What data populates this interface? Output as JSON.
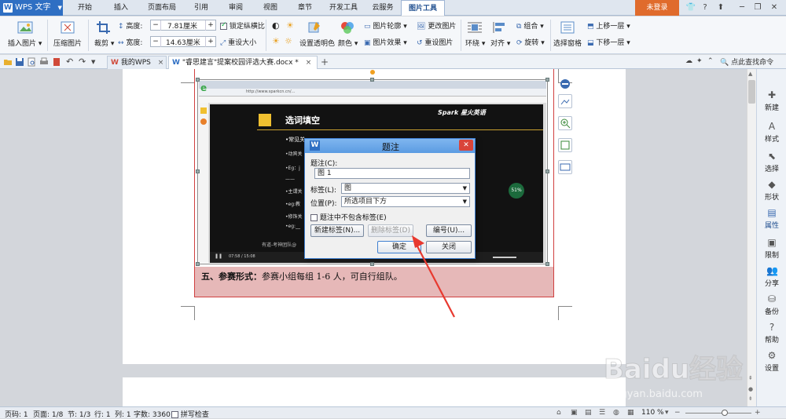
{
  "app": {
    "name": "WPS 文字"
  },
  "menu_tabs": [
    "开始",
    "插入",
    "页面布局",
    "引用",
    "审阅",
    "视图",
    "章节",
    "开发工具",
    "云服务",
    "图片工具"
  ],
  "active_tab": "图片工具",
  "login": "未登录",
  "ribbon": {
    "insert_picture": "插入图片",
    "compress_picture": "压缩图片",
    "crop": "裁剪",
    "height_label": "高度:",
    "height_value": "7.81厘米",
    "width_label": "宽度:",
    "width_value": "14.63厘米",
    "lock_ratio": "锁定纵横比",
    "reset_size": "重设大小",
    "set_transparent": "设置透明色",
    "color": "颜色",
    "outline": "图片轮廓",
    "effect": "图片效果",
    "change_picture": "更改图片",
    "reset_picture": "重设图片",
    "wrap": "环绕",
    "align": "对齐",
    "group": "组合",
    "rotate": "旋转",
    "selection_pane": "选择窗格",
    "bring_forward": "上移一层",
    "send_backward": "下移一层"
  },
  "doc_tabs": {
    "my_wps": "我的WPS",
    "doc_name": "\"睿思建言\"提案校园评选大赛.docx *",
    "search_cmd": "点此查找命令"
  },
  "document": {
    "heading": "五、参赛形式：",
    "body": "参赛小组每组 1-6 人，可自行组队。"
  },
  "embedded_screenshot": {
    "url": "http://www.sparkcn.cn/...",
    "slide_title": "选词填空",
    "brand": "Spark 星火英语",
    "bullets": [
      "•常见关",
      "•动宾关",
      "•Eg：j",
      "——",
      "•主谓关",
      "•eg:教",
      "•修饰关",
      "•eg:__"
    ],
    "footer_text": "有道-考神团队@",
    "time": "07:58 / 15:08",
    "percent": "51%"
  },
  "dialog": {
    "title": "题注",
    "caption_label": "题注(C):",
    "caption_value": "图 1",
    "label_label": "标签(L):",
    "label_value": "图",
    "position_label": "位置(P):",
    "position_value": "所选项目下方",
    "exclude_label": "题注中不包含标签(E)",
    "new_label_btn": "新建标签(N)...",
    "delete_label_btn": "删除标签(D)",
    "numbering_btn": "编号(U)...",
    "ok_btn": "确定",
    "close_btn": "关闭"
  },
  "right_panel": [
    "新建",
    "样式",
    "选择",
    "形状",
    "属性",
    "限制",
    "分享",
    "备份",
    "帮助",
    "设置"
  ],
  "status": {
    "page_num": "页码: 1",
    "pages": "页面: 1/8",
    "section": "节: 1/3",
    "row": "行: 1",
    "col": "列: 1",
    "words": "字数: 3360",
    "spell": "拼写检查",
    "zoom": "110 %"
  },
  "watermark": {
    "brand": "Baidu经验",
    "url": "jingyan.baidu.com"
  },
  "colors": {
    "accent": "#2f6fc3",
    "login": "#e06b2c",
    "pink": "#e6b8b8",
    "arrow": "#e8392f"
  }
}
